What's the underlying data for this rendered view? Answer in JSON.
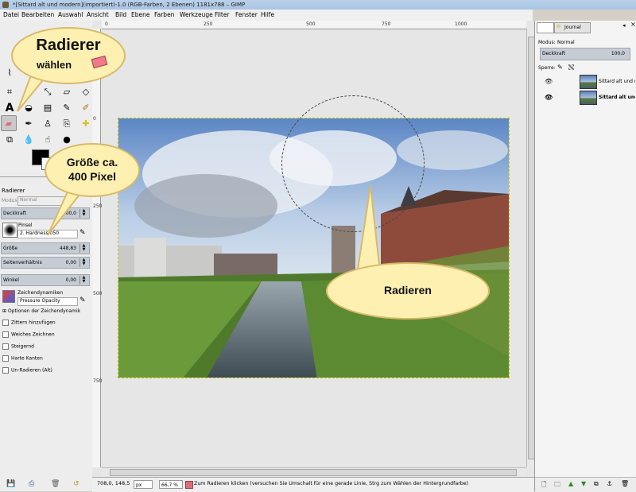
{
  "window": {
    "title": "*[Sittard alt und modern](importiert)-1.0 (RGB-Farben, 2 Ebenen) 1181x788 – GIMP"
  },
  "menu": [
    "Datei",
    "Bearbeiten",
    "Auswahl",
    "Ansicht",
    "Bild",
    "Ebene",
    "Farben",
    "Werkzeuge",
    "Filter",
    "Fenster",
    "Hilfe"
  ],
  "ruler": {
    "h_ticks": [
      "0",
      "250",
      "500",
      "750",
      "1000"
    ],
    "v_ticks": [
      "0",
      "250",
      "500",
      "750"
    ]
  },
  "tool_options": {
    "tool_name": "Radierer",
    "mode_label": "Modus",
    "mode_value": "Normal",
    "opacity_label": "Deckkraft",
    "opacity_value": "100,0",
    "brush_label": "Pinsel",
    "brush_value": "2. Hardness 050",
    "size_label": "Größe",
    "size_value": "448,83",
    "ratio_label": "Seitenverhältnis",
    "ratio_value": "0,00",
    "angle_label": "Winkel",
    "angle_value": "0,00",
    "dynamics_label": "Zeichendynamiken",
    "dynamics_value": "Pressure Opacity",
    "dynamics_options": "Optionen der Zeichendynamik",
    "checks": [
      "Zittern hinzufügen",
      "Weiches Zeichnen",
      "Steigernd",
      "Harte Kanten",
      "Un-Radieren (Alt)"
    ]
  },
  "layers_panel": {
    "tab": "Journal",
    "mode_label": "Modus:",
    "mode_value": "Normal",
    "opacity_label": "Deckkraft",
    "opacity_value": "100,0",
    "lock_label": "Sperre:",
    "layers": [
      {
        "name": "Sittard alt und modern",
        "active": false
      },
      {
        "name": "Sittard alt und modern",
        "active": true
      }
    ]
  },
  "status": {
    "coords": "708,0, 148,5",
    "unit": "px",
    "zoom": "66,7 %",
    "message": "Zum Radieren klicken (versuchen Sie Umschalt für eine gerade Linie, Strg zum Wählen der Hintergrundfarbe)"
  },
  "annotations": {
    "bubble1_title": "Radierer",
    "bubble1_sub": "wählen",
    "bubble2_line1": "Größe ca.",
    "bubble2_line2": "400 Pixel",
    "bubble3": "Radieren"
  },
  "colors": {
    "accent": "#c5ccd4",
    "bubble_fill": "#fdf0b0",
    "bubble_border": "#d9b96a"
  }
}
